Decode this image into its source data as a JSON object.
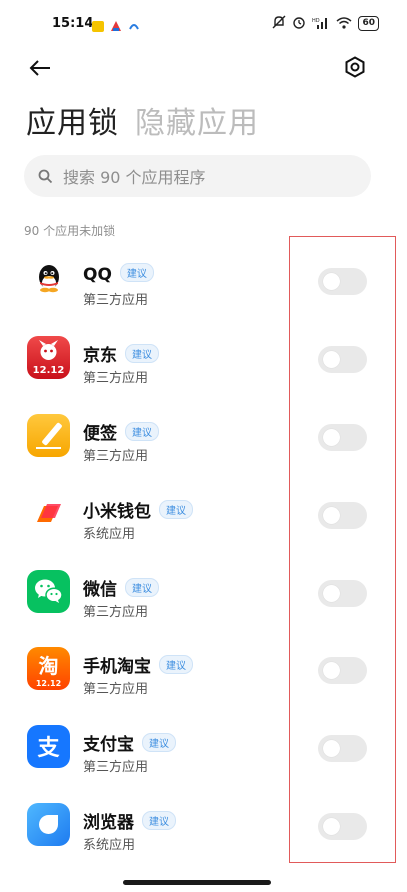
{
  "status": {
    "time": "15:14",
    "battery": "60"
  },
  "tabs": [
    {
      "label": "应用锁",
      "active": true
    },
    {
      "label": "隐藏应用",
      "active": false
    }
  ],
  "search": {
    "placeholder": "搜索 90 个应用程序"
  },
  "list_header": "90 个应用未加锁",
  "apps": [
    {
      "name": "QQ",
      "badge": "建议",
      "type": "第三方应用",
      "icon": "qq-icon",
      "locked": false
    },
    {
      "name": "京东",
      "badge": "建议",
      "type": "第三方应用",
      "icon": "jd-icon",
      "locked": false
    },
    {
      "name": "便签",
      "badge": "建议",
      "type": "第三方应用",
      "icon": "notes-icon",
      "locked": false
    },
    {
      "name": "小米钱包",
      "badge": "建议",
      "type": "系统应用",
      "icon": "mi-wallet-icon",
      "locked": false
    },
    {
      "name": "微信",
      "badge": "建议",
      "type": "第三方应用",
      "icon": "wechat-icon",
      "locked": false
    },
    {
      "name": "手机淘宝",
      "badge": "建议",
      "type": "第三方应用",
      "icon": "taobao-icon",
      "locked": false
    },
    {
      "name": "支付宝",
      "badge": "建议",
      "type": "第三方应用",
      "icon": "alipay-icon",
      "locked": false
    },
    {
      "name": "浏览器",
      "badge": "建议",
      "type": "系统应用",
      "icon": "browser-icon",
      "locked": false
    }
  ],
  "icon_labels": {
    "jd": "12.12",
    "taobao_char": "淘",
    "taobao_sub": "12.12",
    "alipay_char": "支"
  },
  "colors": {
    "highlight": "#e15a5a",
    "badge_text": "#3d8ee0",
    "toggle_off": "#e9e9e9"
  }
}
